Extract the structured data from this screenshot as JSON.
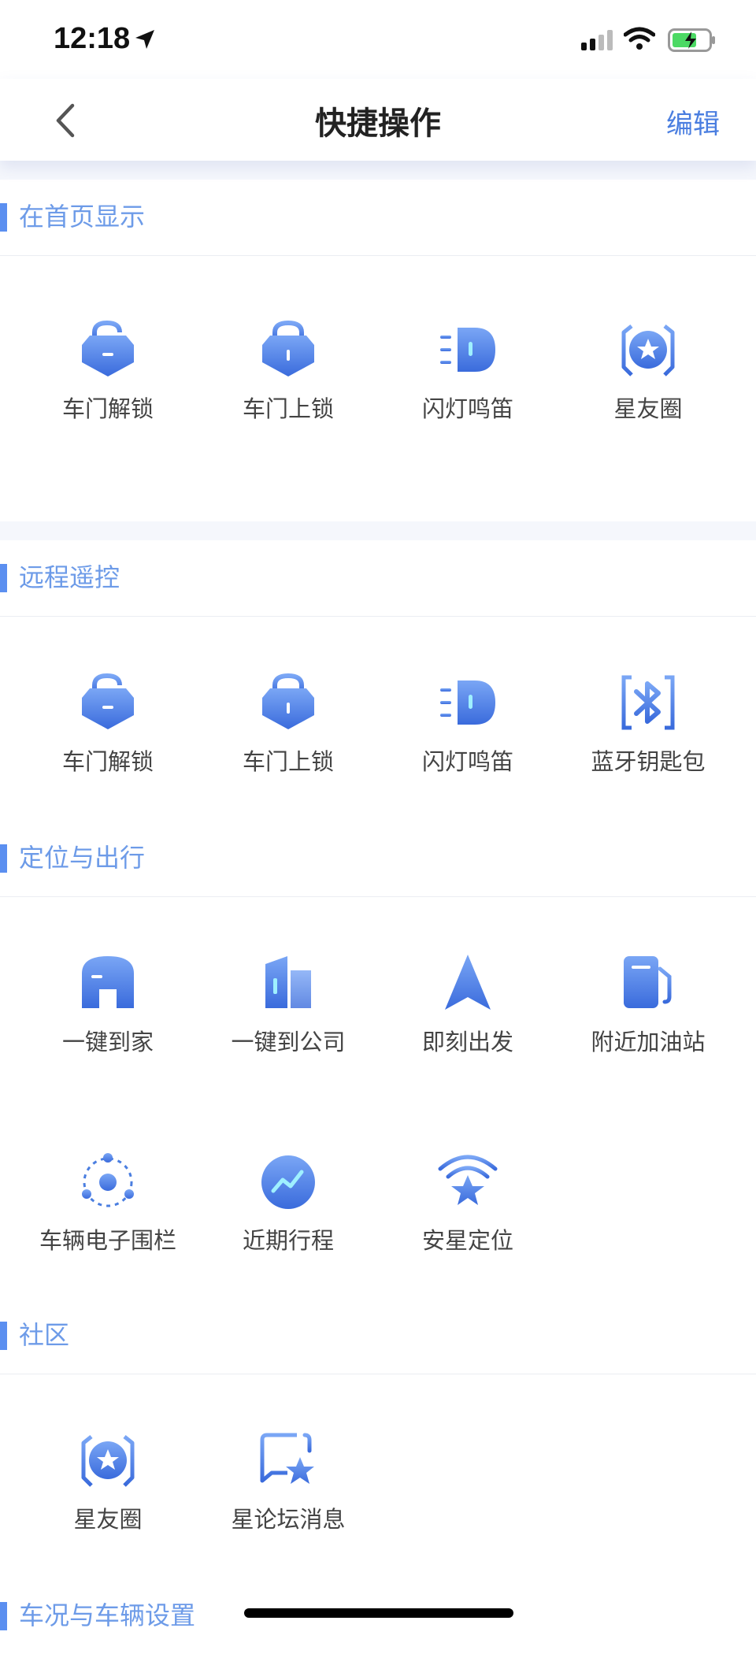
{
  "status": {
    "time": "12:18"
  },
  "nav": {
    "title": "快捷操作",
    "edit_label": "编辑"
  },
  "sections": {
    "home": {
      "title": "在首页显示",
      "items": [
        "车门解锁",
        "车门上锁",
        "闪灯鸣笛",
        "星友圈"
      ]
    },
    "remote": {
      "title": "远程遥控",
      "items": [
        "车门解锁",
        "车门上锁",
        "闪灯鸣笛",
        "蓝牙钥匙包"
      ]
    },
    "travel": {
      "title": "定位与出行",
      "items": [
        "一键到家",
        "一键到公司",
        "即刻出发",
        "附近加油站",
        "车辆电子围栏",
        "近期行程",
        "安星定位"
      ]
    },
    "community": {
      "title": "社区",
      "items": [
        "星友圈",
        "星论坛消息"
      ]
    },
    "vehicle": {
      "title": "车况与车辆设置"
    }
  },
  "colors": {
    "accent": "#4a7ee0",
    "icon_gradient_top": "#7aa6f5",
    "icon_gradient_bottom": "#3a6bdc"
  }
}
